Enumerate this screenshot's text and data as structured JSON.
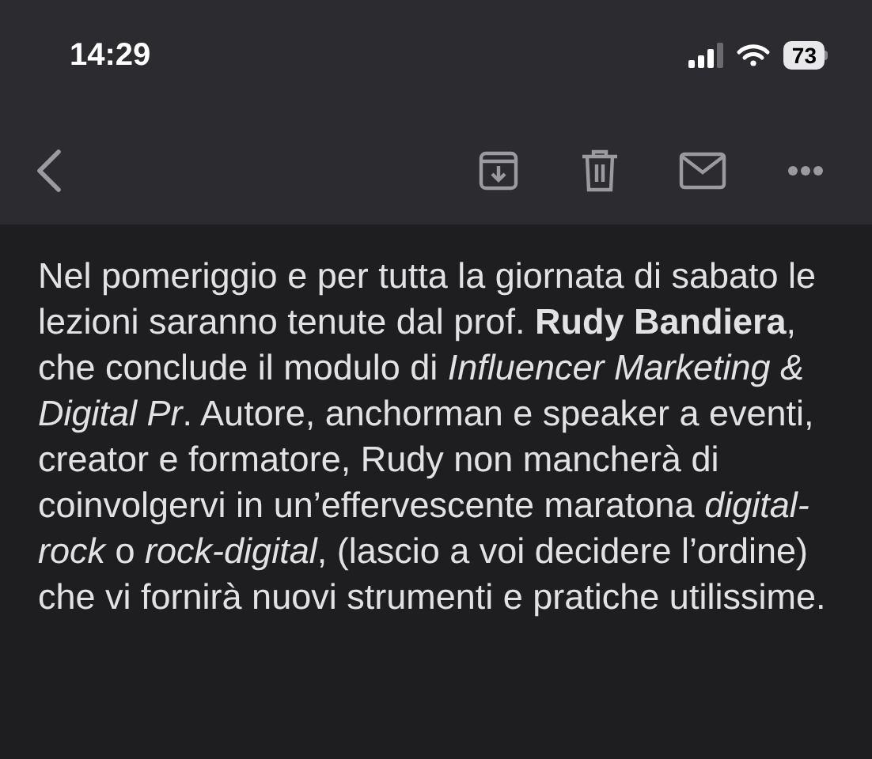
{
  "status_bar": {
    "time": "14:29",
    "battery": "73"
  },
  "toolbar": {
    "actions": [
      {
        "kind": "archive"
      },
      {
        "kind": "delete"
      },
      {
        "kind": "mail"
      },
      {
        "kind": "more"
      }
    ]
  },
  "body": "Nel pomeriggio e per tutta la giornata di sabato le lezioni saranno tenute dal prof. **Rudy Bandiera**, che conclude il modulo di *Influencer Marketing & Digital Pr*. Autore, anchorman e speaker a eventi, creator e formatore, Rudy non mancherà di coinvolgervi in un’effervescente maratona *digital-rock* o *rock-digital*, (lascio a voi decidere l’ordine) che vi fornirà nuovi strumenti e pratiche utilissime."
}
